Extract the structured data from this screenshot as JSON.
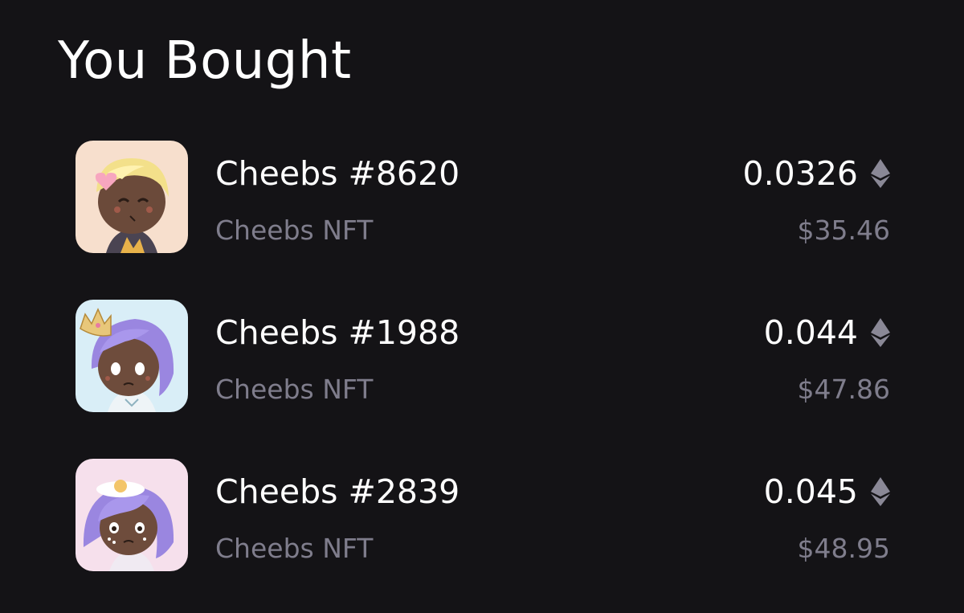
{
  "page": {
    "title": "You Bought"
  },
  "colors": {
    "background": "#141316",
    "primary_text": "#ffffff",
    "secondary_text": "#7f7d8c",
    "eth_icon": "#8a8896"
  },
  "items": [
    {
      "name": "Cheebs #8620",
      "collection": "Cheebs NFT",
      "price_eth": "0.0326",
      "price_usd": "$35.46",
      "currency_icon": "ethereum-icon",
      "avatar_bg": "#f7dfcd"
    },
    {
      "name": "Cheebs #1988",
      "collection": "Cheebs NFT",
      "price_eth": "0.044",
      "price_usd": "$47.86",
      "currency_icon": "ethereum-icon",
      "avatar_bg": "#d9eef7"
    },
    {
      "name": "Cheebs #2839",
      "collection": "Cheebs NFT",
      "price_eth": "0.045",
      "price_usd": "$48.95",
      "currency_icon": "ethereum-icon",
      "avatar_bg": "#f6e0ec"
    }
  ]
}
